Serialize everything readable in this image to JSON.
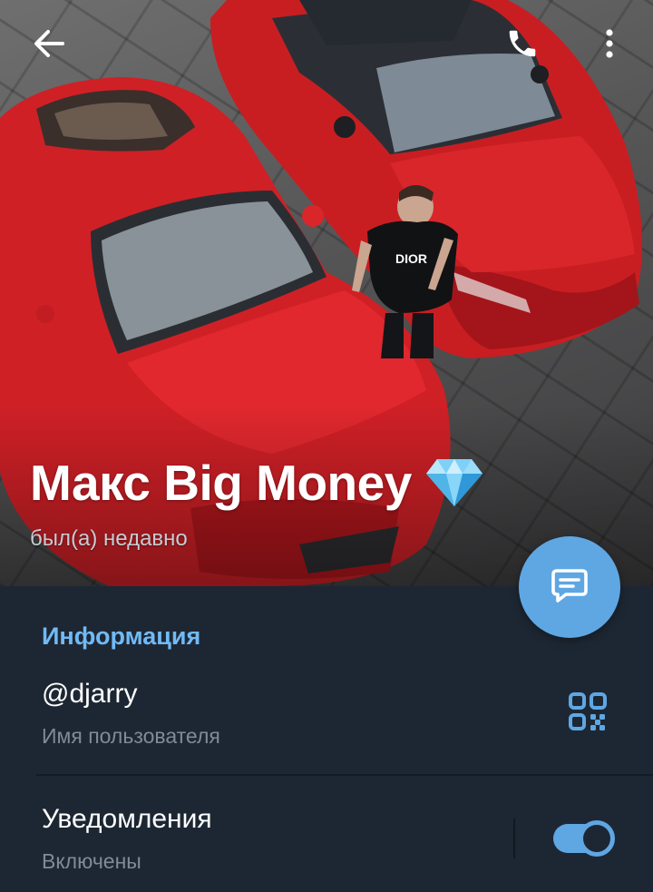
{
  "profile": {
    "name": "Макс Big Money",
    "status": "был(а) недавно"
  },
  "info": {
    "section_title": "Информация",
    "username": "@djarry",
    "username_caption": "Имя пользователя",
    "notifications_title": "Уведомления",
    "notifications_status": "Включены",
    "notifications_enabled": true
  },
  "icons": {
    "back": "arrow-left-icon",
    "call": "phone-icon",
    "more": "more-vertical-icon",
    "emoji": "gem-icon",
    "message": "chat-bubble-icon",
    "qr": "qr-code-icon"
  },
  "colors": {
    "accent": "#5fa7e3",
    "section_title": "#71baf5",
    "panel_bg": "#1d2733",
    "caption": "#808b96"
  }
}
